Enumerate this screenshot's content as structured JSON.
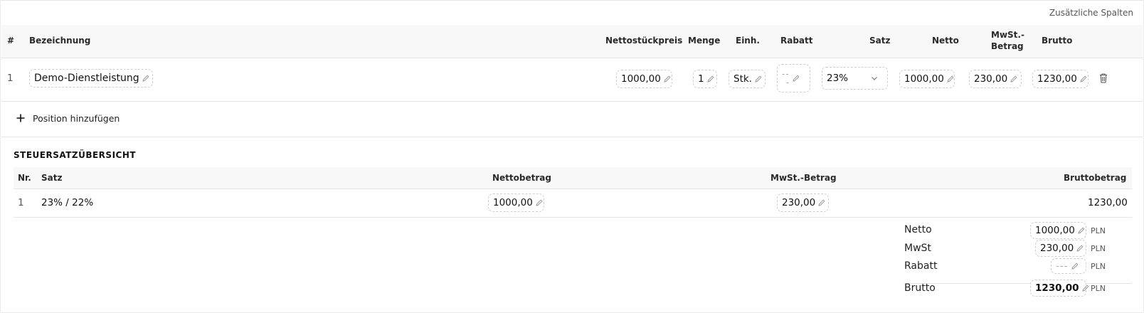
{
  "toolbar": {
    "extra_columns_label": "Zusätzliche Spalten"
  },
  "items_table": {
    "headers": {
      "num": "#",
      "name": "Bezeichnung",
      "unit_price": "Nettostückpreis",
      "qty": "Menge",
      "unit": "Einh.",
      "discount": "Rabatt",
      "rate": "Satz",
      "net": "Netto",
      "vat_line1": "MwSt.-",
      "vat_line2": "Betrag",
      "gross": "Brutto"
    },
    "rows": [
      {
        "num": "1",
        "name": "Demo-Dienstleistung",
        "unit_price": "1000,00",
        "qty": "1",
        "unit": "Stk.",
        "discount_top": "--",
        "discount_bottom": "-",
        "rate": "23%",
        "net": "1000,00",
        "vat": "230,00",
        "gross": "1230,00"
      }
    ],
    "add_position_label": "Position hinzufügen"
  },
  "tax_summary": {
    "title": "STEUERSATZÜBERSICHT",
    "headers": {
      "nr": "Nr.",
      "rate": "Satz",
      "net": "Nettobetrag",
      "vat": "MwSt.-Betrag",
      "gross": "Bruttobetrag"
    },
    "rows": [
      {
        "nr": "1",
        "rate": "23% / 22%",
        "net": "1000,00",
        "vat": "230,00",
        "gross": "1230,00"
      }
    ]
  },
  "totals": {
    "net_label": "Netto",
    "net_value": "1000,00",
    "vat_label": "MwSt",
    "vat_value": "230,00",
    "discount_label": "Rabatt",
    "discount_value": "---",
    "gross_label": "Brutto",
    "gross_value": "1230,00",
    "currency": "PLN"
  },
  "icons": {
    "edit": "pencil-icon",
    "delete": "trash-icon",
    "add": "plus-icon",
    "select": "chevron-down-icon"
  }
}
